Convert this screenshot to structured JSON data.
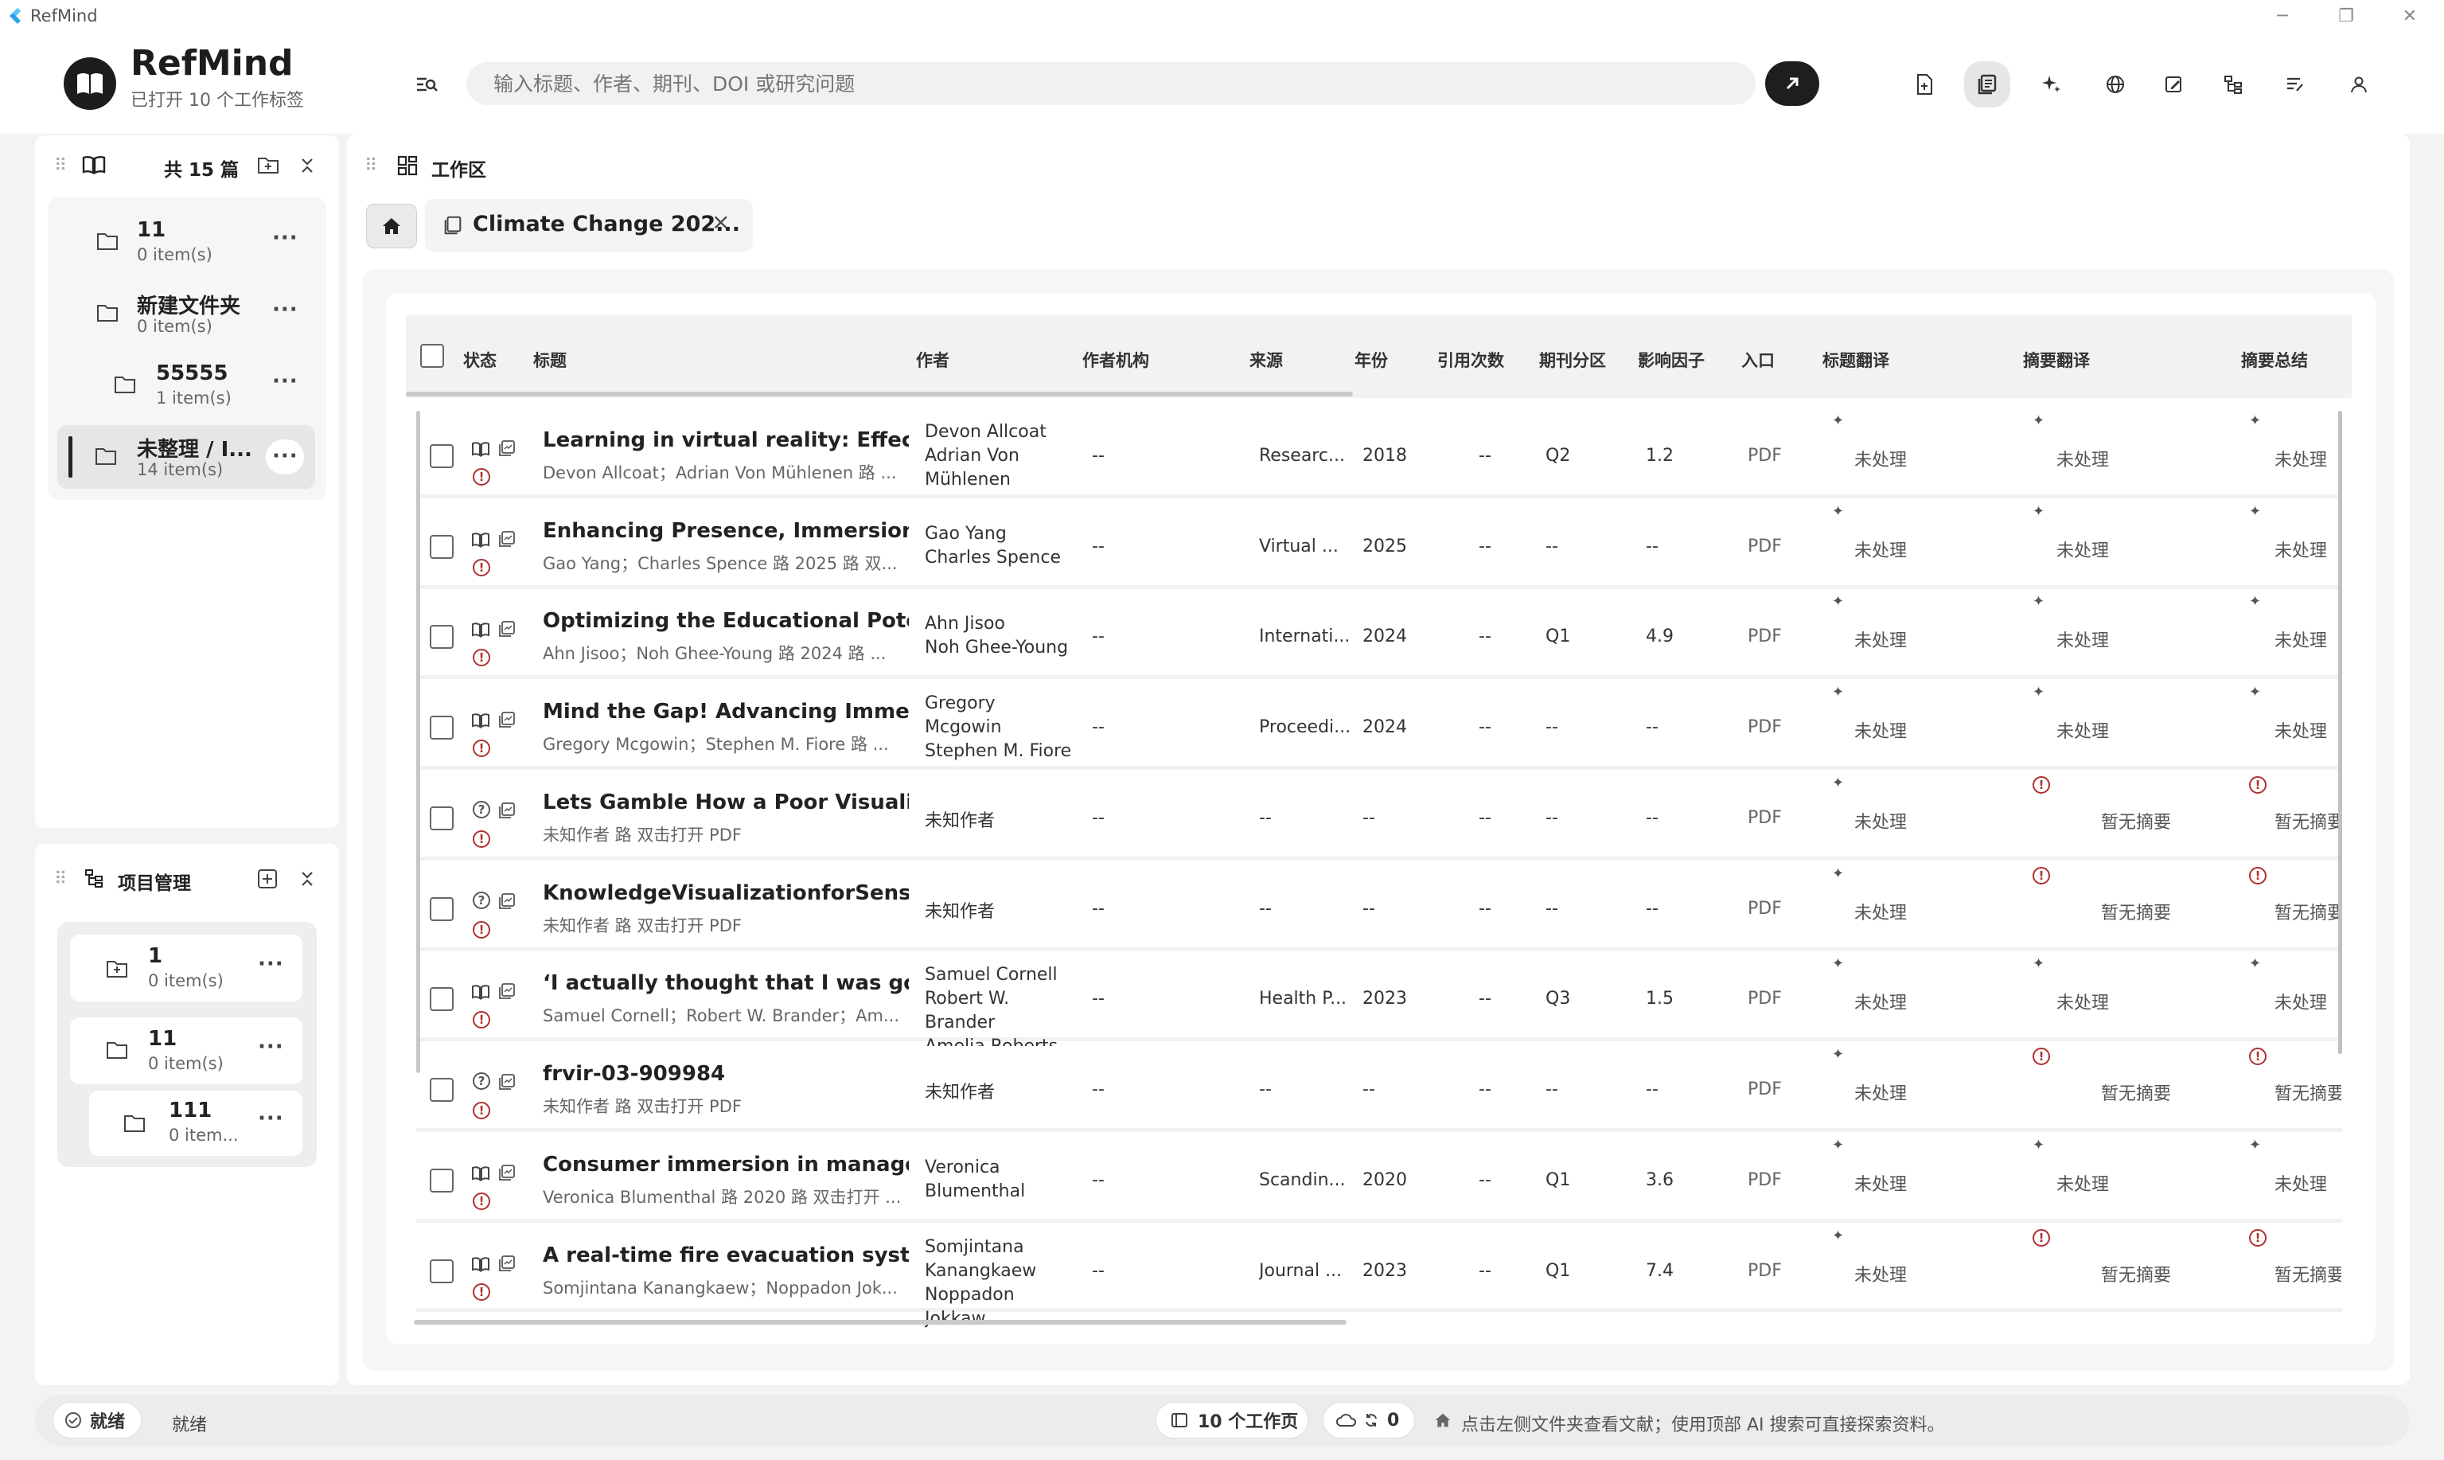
{
  "app": {
    "title": "RefMind"
  },
  "header": {
    "brand_name": "RefMind",
    "brand_subtitle": "已打开 10 个工作标签",
    "search_placeholder": "输入标题、作者、期刊、DOI 或研究问题"
  },
  "library_panel": {
    "count_label": "共 15 篇",
    "folders": [
      {
        "name": "11",
        "count": "0 item(s)"
      },
      {
        "name": "新建文件夹",
        "count": "0 item(s)"
      },
      {
        "name": "55555",
        "count": "1 item(s)"
      },
      {
        "name": "未整理 / I...",
        "count": "14 item(s)"
      }
    ]
  },
  "project_panel": {
    "title": "项目管理",
    "items": [
      {
        "name": "1",
        "count": "0 item(s)"
      },
      {
        "name": "11",
        "count": "0 item(s)"
      },
      {
        "name": "111",
        "count": "0 item..."
      }
    ]
  },
  "workspace": {
    "title": "工作区",
    "tab_label": "Climate Change 202..."
  },
  "table": {
    "headers": [
      "状态",
      "标题",
      "作者",
      "作者机构",
      "来源",
      "年份",
      "引用次数",
      "期刊分区",
      "影响因子",
      "入口",
      "标题翻译",
      "摘要翻译",
      "摘要总结"
    ],
    "rows": [
      {
        "title": "Learning in virtual reality: Effects ...",
        "sub": "Devon Allcoat；Adrian Von Mühlenen 路 ...",
        "authors": [
          "Devon Allcoat",
          "Adrian Von",
          "Mühlenen"
        ],
        "affil": "--",
        "source": "Researc...",
        "year": "2018",
        "citations": "--",
        "quartile": "Q2",
        "impact": "1.2",
        "entry": "PDF",
        "title_tr": "未处理",
        "abs_tr": "未处理",
        "abs_sum": "未处理",
        "unknown": false,
        "abs_alert": false
      },
      {
        "title": "Enhancing Presence, Immersion, a...",
        "sub": "Gao Yang；Charles Spence 路 2025 路 双...",
        "authors": [
          "Gao Yang",
          "Charles Spence"
        ],
        "affil": "--",
        "source": "Virtual ...",
        "year": "2025",
        "citations": "--",
        "quartile": "--",
        "impact": "--",
        "entry": "PDF",
        "title_tr": "未处理",
        "abs_tr": "未处理",
        "abs_sum": "未处理",
        "unknown": false,
        "abs_alert": false
      },
      {
        "title": "Optimizing the Educational Poten...",
        "sub": "Ahn Jisoo；Noh Ghee-Young 路 2024 路 ...",
        "authors": [
          "Ahn Jisoo",
          "Noh Ghee-Young"
        ],
        "affil": "--",
        "source": "Internati...",
        "year": "2024",
        "citations": "--",
        "quartile": "Q1",
        "impact": "4.9",
        "entry": "PDF",
        "title_tr": "未处理",
        "abs_tr": "未处理",
        "abs_sum": "未处理",
        "unknown": false,
        "abs_alert": false
      },
      {
        "title": "Mind the Gap! Advancing Immers...",
        "sub": "Gregory Mcgowin；Stephen M. Fiore 路 ...",
        "authors": [
          "Gregory",
          "Mcgowin",
          "Stephen M. Fiore"
        ],
        "affil": "--",
        "source": "Proceedi...",
        "year": "2024",
        "citations": "--",
        "quartile": "--",
        "impact": "--",
        "entry": "PDF",
        "title_tr": "未处理",
        "abs_tr": "未处理",
        "abs_sum": "未处理",
        "unknown": false,
        "abs_alert": false
      },
      {
        "title": "Lets Gamble How a Poor Visuali...",
        "sub": "未知作者 路 双击打开 PDF",
        "authors": [
          "未知作者"
        ],
        "affil": "--",
        "source": "--",
        "year": "--",
        "citations": "--",
        "quartile": "--",
        "impact": "--",
        "entry": "PDF",
        "title_tr": "未处理",
        "abs_tr": "暂无摘要",
        "abs_sum": "暂无摘要",
        "unknown": true,
        "abs_alert": true
      },
      {
        "title": "KnowledgeVisualizationforSense...",
        "sub": "未知作者 路 双击打开 PDF",
        "authors": [
          "未知作者"
        ],
        "affil": "--",
        "source": "--",
        "year": "--",
        "citations": "--",
        "quartile": "--",
        "impact": "--",
        "entry": "PDF",
        "title_tr": "未处理",
        "abs_tr": "暂无摘要",
        "abs_sum": "暂无摘要",
        "unknown": true,
        "abs_alert": true
      },
      {
        "title": "‘I actually thought that I was goin...",
        "sub": "Samuel Cornell；Robert W. Brander；Am...",
        "authors": [
          "Samuel Cornell",
          "Robert W.",
          "Brander",
          "Amelia Roberts"
        ],
        "affil": "--",
        "source": "Health P...",
        "year": "2023",
        "citations": "--",
        "quartile": "Q3",
        "impact": "1.5",
        "entry": "PDF",
        "title_tr": "未处理",
        "abs_tr": "未处理",
        "abs_sum": "未处理",
        "unknown": false,
        "abs_alert": false
      },
      {
        "title": "frvir-03-909984",
        "sub": "未知作者 路 双击打开 PDF",
        "authors": [
          "未知作者"
        ],
        "affil": "--",
        "source": "--",
        "year": "--",
        "citations": "--",
        "quartile": "--",
        "impact": "--",
        "entry": "PDF",
        "title_tr": "未处理",
        "abs_tr": "暂无摘要",
        "abs_sum": "暂无摘要",
        "unknown": true,
        "abs_alert": true
      },
      {
        "title": "Consumer immersion in managed...",
        "sub": "Veronica Blumenthal 路 2020 路 双击打开 ...",
        "authors": [
          "Veronica",
          "Blumenthal"
        ],
        "affil": "--",
        "source": "Scandin...",
        "year": "2020",
        "citations": "--",
        "quartile": "Q1",
        "impact": "3.6",
        "entry": "PDF",
        "title_tr": "未处理",
        "abs_tr": "未处理",
        "abs_sum": "未处理",
        "unknown": false,
        "abs_alert": false
      },
      {
        "title": "A real-time fire evacuation syste...",
        "sub": "Somjintana Kanangkaew；Noppadon Jok...",
        "authors": [
          "Somjintana",
          "Kanangkaew",
          "Noppadon",
          "Jokkaw"
        ],
        "affil": "--",
        "source": "Journal ...",
        "year": "2023",
        "citations": "--",
        "quartile": "Q1",
        "impact": "7.4",
        "entry": "PDF",
        "title_tr": "未处理",
        "abs_tr": "暂无摘要",
        "abs_sum": "暂无摘要",
        "unknown": false,
        "abs_alert": true
      }
    ]
  },
  "statusbar": {
    "status_pill": "就绪",
    "status_text": "就绪",
    "workspaces": "10 个工作页",
    "sync_count": "0",
    "hint": "点击左侧文件夹查看文献；使用顶部 AI 搜索可直接探索资料。"
  }
}
